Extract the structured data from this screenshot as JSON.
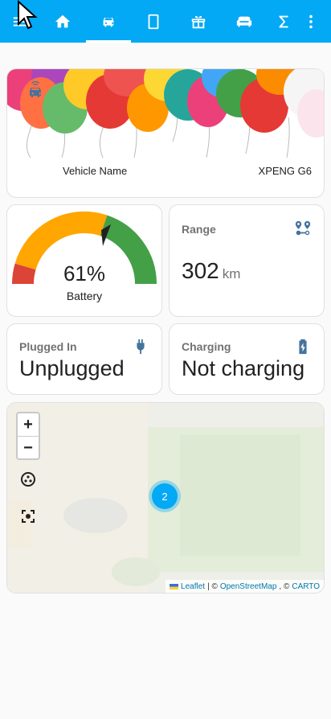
{
  "topbar": {
    "tabs": [
      {
        "icon": "menu-icon"
      },
      {
        "icon": "home-icon"
      },
      {
        "icon": "car-icon",
        "active": true
      },
      {
        "icon": "tablet-icon"
      },
      {
        "icon": "gift-icon"
      },
      {
        "icon": "sofa-icon"
      },
      {
        "icon": "sigma-icon"
      },
      {
        "icon": "more-vert-icon"
      }
    ],
    "colors": {
      "bar": "#03a9f4"
    }
  },
  "vehicle": {
    "label": "Vehicle Name",
    "value": "XPENG G6"
  },
  "battery": {
    "value_text": "61%",
    "value": 61,
    "name": "Battery",
    "colors": {
      "low": "#db4437",
      "mid": "#ffa600",
      "high": "#43a047"
    }
  },
  "range": {
    "title": "Range",
    "value": "302",
    "unit": "km"
  },
  "plug": {
    "title": "Plugged In",
    "value": "Unplugged"
  },
  "charging": {
    "title": "Charging",
    "value": "Not charging"
  },
  "map": {
    "zoom_in": "+",
    "zoom_out": "−",
    "cluster_count": "2",
    "attribution": {
      "leaflet": "Leaflet",
      "sep1": "| ©",
      "osm": "OpenStreetMap",
      "sep2": ", ©",
      "carto": "CARTO"
    }
  }
}
